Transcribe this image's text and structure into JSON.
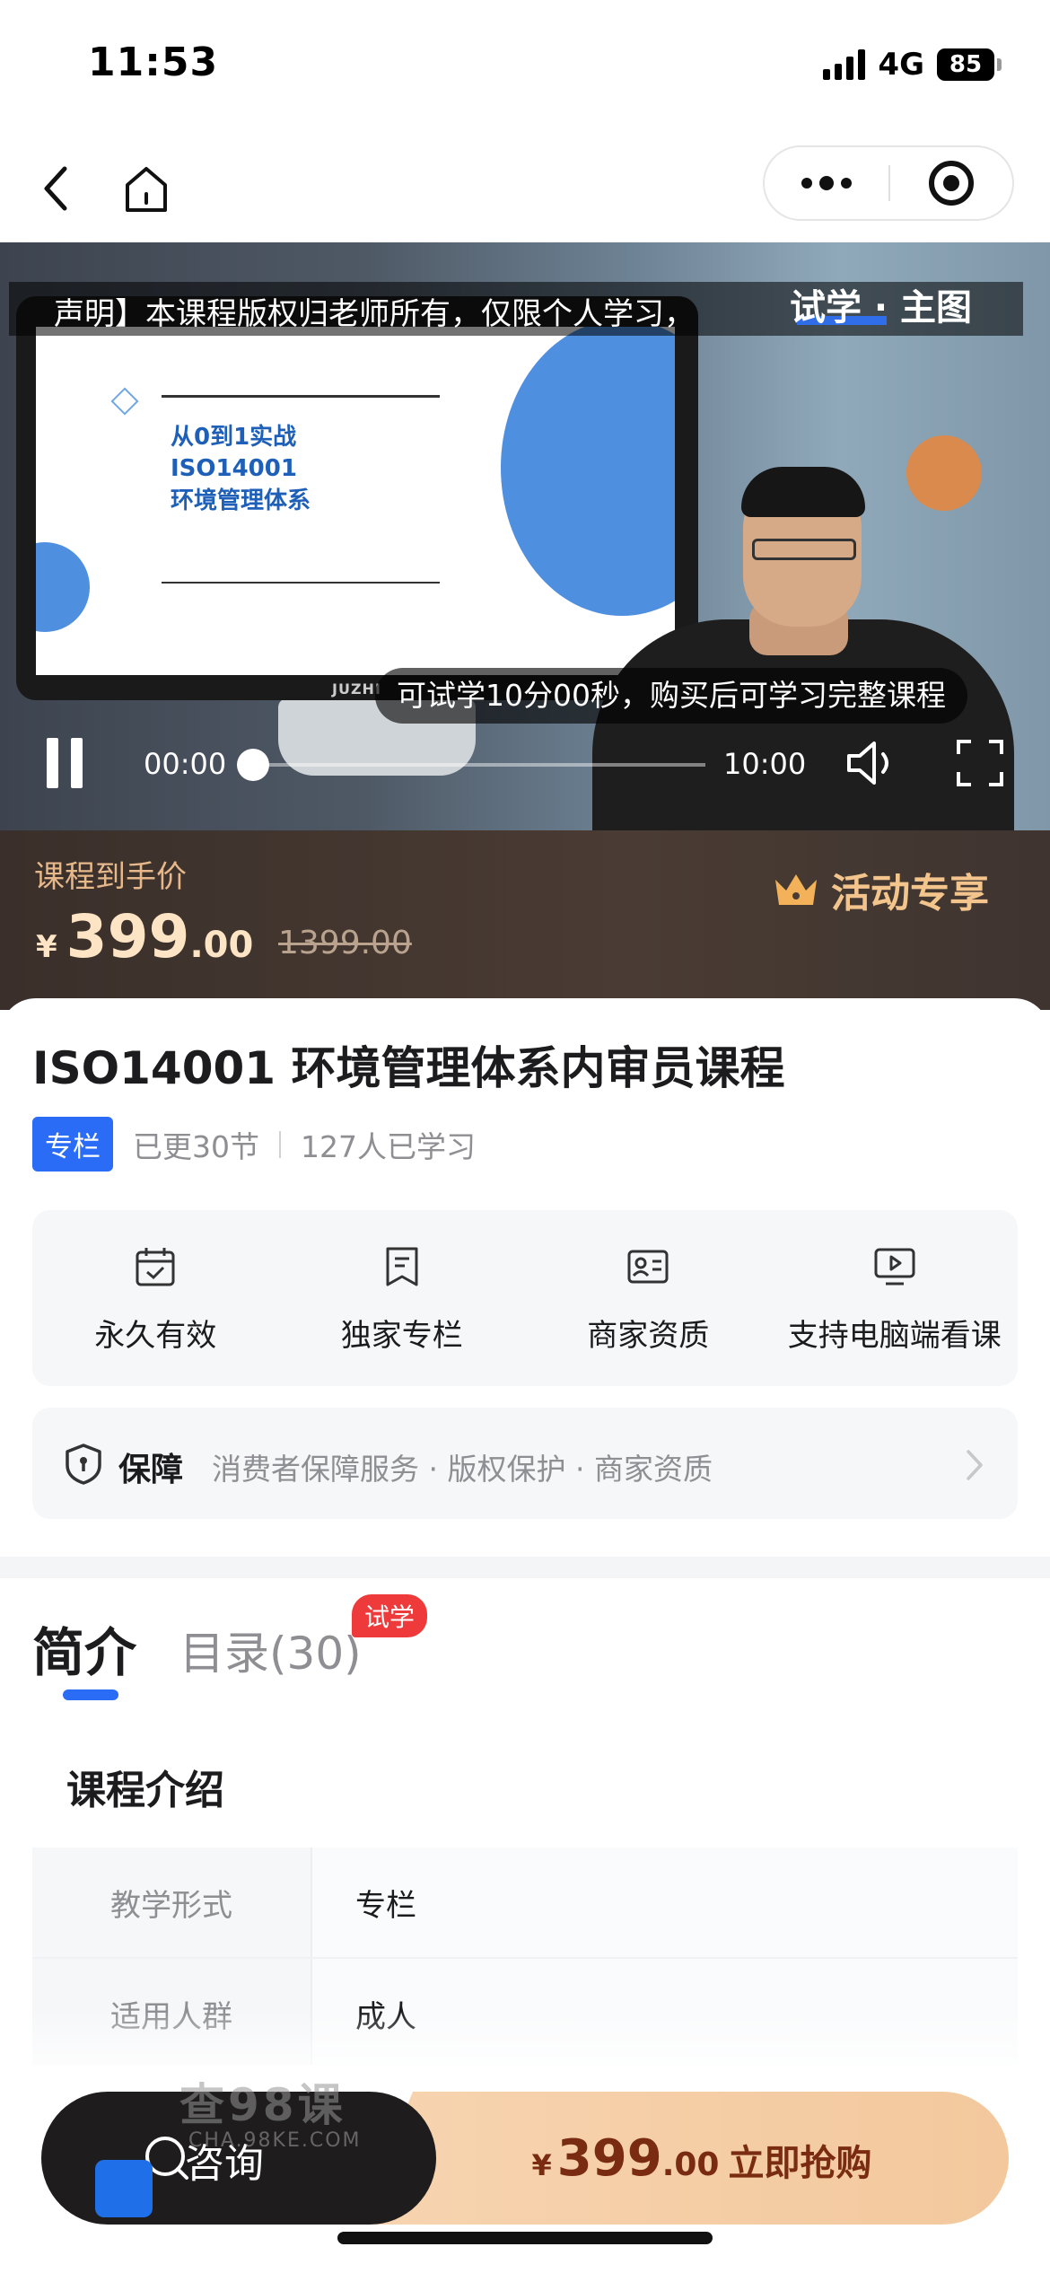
{
  "status_bar": {
    "time": "11:53",
    "network": "4G",
    "battery": "85"
  },
  "video": {
    "watermark_notice": "声明】本课程版权归老师所有，仅限个人学习，",
    "trial_logo": "试学 · 主图",
    "slide_title_line1": "从0到1实战",
    "slide_title_line2": "ISO14001",
    "slide_title_line3": "环境管理体系",
    "monitor_brand": "JUZHI",
    "trial_hint": "可试学10分00秒，购买后可学习完整课程",
    "current_time": "00:00",
    "total_time": "10:00",
    "progress": 0
  },
  "price": {
    "label": "课程到手价",
    "currency": "¥",
    "integer": "399",
    "decimal": ".00",
    "original": "1399.00",
    "promo": "活动专享"
  },
  "course": {
    "title": "ISO14001 环境管理体系内审员课程",
    "badge": "专栏",
    "updated": "已更30节",
    "learners": "127人已学习"
  },
  "features": [
    {
      "icon": "calendar-check-icon",
      "label": "永久有效"
    },
    {
      "icon": "bookmark-doc-icon",
      "label": "独家专栏"
    },
    {
      "icon": "id-card-icon",
      "label": "商家资质"
    },
    {
      "icon": "monitor-play-icon",
      "label": "支持电脑端看课"
    }
  ],
  "guarantee": {
    "title": "保障",
    "items": "消费者保障服务 · 版权保护 · 商家资质"
  },
  "tabs": {
    "intro": "简介",
    "catalog": "目录(30)",
    "trial_badge": "试学"
  },
  "intro": {
    "section_title": "课程介绍",
    "rows": [
      {
        "key": "教学形式",
        "value": "专栏"
      },
      {
        "key": "适用人群",
        "value": "成人"
      }
    ]
  },
  "bottom": {
    "consult": "咨询",
    "buy_currency": "¥",
    "buy_integer": "399",
    "buy_decimal": ".00",
    "buy_label": "立即抢购",
    "site_watermark": "查98课",
    "site_watermark_sub": "CHA.98KE.COM"
  },
  "colors": {
    "accent": "#2a6cf6",
    "price_band": "#3a2f2a",
    "buy_gradient": "#f7d4b0",
    "trial_badge": "#ee3a3a"
  }
}
